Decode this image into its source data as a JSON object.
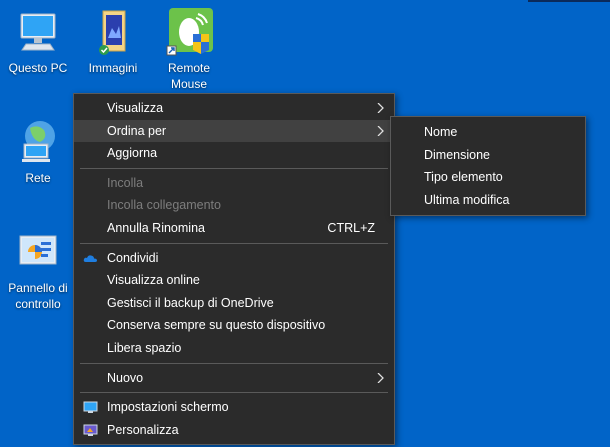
{
  "desktop": {
    "icons": [
      {
        "label": "Questo PC",
        "icon": "computer-icon"
      },
      {
        "label": "Immagini",
        "icon": "pictures-folder-icon"
      },
      {
        "label": "Remote Mouse",
        "icon": "remote-mouse-app-icon"
      },
      {
        "label": "Rete",
        "icon": "network-globe-icon"
      },
      {
        "label": "Pannello di controllo",
        "icon": "control-panel-icon"
      }
    ]
  },
  "context_menu": {
    "visualizza": "Visualizza",
    "ordina_per": "Ordina per",
    "aggiorna": "Aggiorna",
    "incolla": "Incolla",
    "incolla_collegamento": "Incolla collegamento",
    "annulla_rinomina": "Annulla Rinomina",
    "annulla_shortcut": "CTRL+Z",
    "condividi": "Condividi",
    "visualizza_online": "Visualizza online",
    "gestisci_backup": "Gestisci il backup di OneDrive",
    "conserva_sempre": "Conserva sempre su questo dispositivo",
    "libera_spazio": "Libera spazio",
    "nuovo": "Nuovo",
    "impostazioni_schermo": "Impostazioni schermo",
    "personalizza": "Personalizza"
  },
  "submenu": {
    "items": [
      "Nome",
      "Dimensione",
      "Tipo elemento",
      "Ultima modifica"
    ]
  },
  "colors": {
    "desktop_bg": "#0164c8",
    "menu_bg": "#2b2b2b",
    "menu_highlight": "#414141",
    "onedrive_blue": "#1f7ee0"
  }
}
